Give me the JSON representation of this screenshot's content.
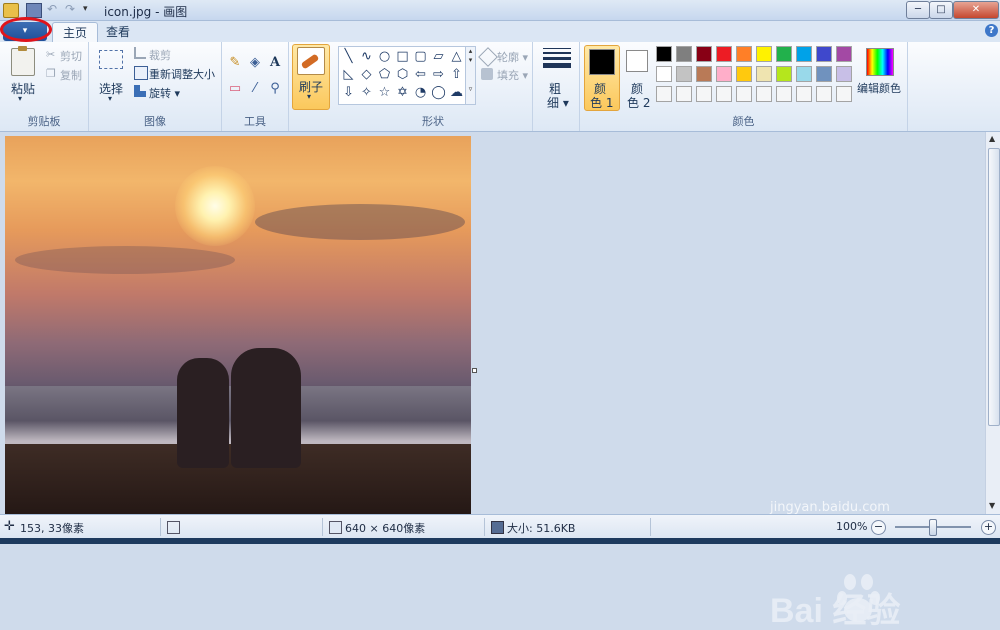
{
  "window": {
    "title": "icon.jpg - 画图",
    "undo_glyph": "↶",
    "redo_glyph": "↷",
    "customize_glyph": "▾",
    "minimize_glyph": "─",
    "maximize_glyph": "□",
    "close_glyph": "✕"
  },
  "tabs": {
    "app_menu_glyph": "▾",
    "home": "主页",
    "view": "查看",
    "help_glyph": "?"
  },
  "ribbon": {
    "clipboard": {
      "group_label": "剪贴板",
      "paste": "粘贴",
      "cut": "剪切",
      "copy": "复制",
      "dropdown_glyph": "▾"
    },
    "image": {
      "group_label": "图像",
      "select": "选择",
      "crop": "裁剪",
      "resize": "重新调整大小",
      "rotate": "旋转 ▾",
      "dropdown_glyph": "▾"
    },
    "tools": {
      "group_label": "工具",
      "pencil_glyph": "✎",
      "fill_glyph": "◈",
      "text_glyph": "A",
      "eraser_glyph": "▭",
      "picker_glyph": "⁄",
      "magnifier_glyph": "⚲"
    },
    "brush": {
      "label": "刷子",
      "dropdown_glyph": "▾"
    },
    "shapes": {
      "group_label": "形状",
      "outline": "轮廓 ▾",
      "fill": "填充 ▾",
      "items": [
        "╲",
        "∿",
        "○",
        "□",
        "▢",
        "▱",
        "△",
        "◺",
        "◇",
        "⬠",
        "⬡",
        "⇦",
        "⇨",
        "⇧",
        "⇩",
        "✧",
        "☆",
        "✡",
        "◔",
        "◯",
        "☁"
      ],
      "scroll_up": "▴",
      "scroll_down": "▾",
      "scroll_more": "▿"
    },
    "size": {
      "label_line1": "粗",
      "label_line2": "细 ▾"
    },
    "colors": {
      "group_label": "颜色",
      "color1_line1": "颜",
      "color1_line2": "色 1",
      "color2_line1": "颜",
      "color2_line2": "色 2",
      "color1": "#000000",
      "color2": "#ffffff",
      "edit_colors": "编辑颜色",
      "palette_row1": [
        "#000000",
        "#7f7f7f",
        "#880015",
        "#ed1c24",
        "#ff7f27",
        "#fff200",
        "#22b14c",
        "#00a2e8",
        "#3f48cc",
        "#a349a4"
      ],
      "palette_row2": [
        "#ffffff",
        "#c3c3c3",
        "#b97a57",
        "#ffaec9",
        "#ffc90e",
        "#efe4b0",
        "#b5e61d",
        "#99d9ea",
        "#7092be",
        "#c8bfe7"
      ],
      "palette_row3": [
        "#f5f6f7",
        "#f5f6f7",
        "#f5f6f7",
        "#f5f6f7",
        "#f5f6f7",
        "#f5f6f7",
        "#f5f6f7",
        "#f5f6f7",
        "#f5f6f7",
        "#f5f6f7"
      ]
    }
  },
  "canvas": {
    "image_subject": "sunset silhouette couple on beach"
  },
  "scrollbar": {
    "up_glyph": "▲",
    "down_glyph": "▼"
  },
  "watermark": {
    "brand": "Bai  经验",
    "url": "jingyan.baidu.com"
  },
  "statusbar": {
    "cursor_pos": "153, 33像素",
    "image_size": "640 × 640像素",
    "file_size": "大小: 51.6KB",
    "zoom": "100%",
    "zoom_minus": "−",
    "zoom_plus": "+"
  },
  "colors": {
    "highlight_annotation": "#e0141b",
    "ribbon_active": "#fbc85c"
  }
}
